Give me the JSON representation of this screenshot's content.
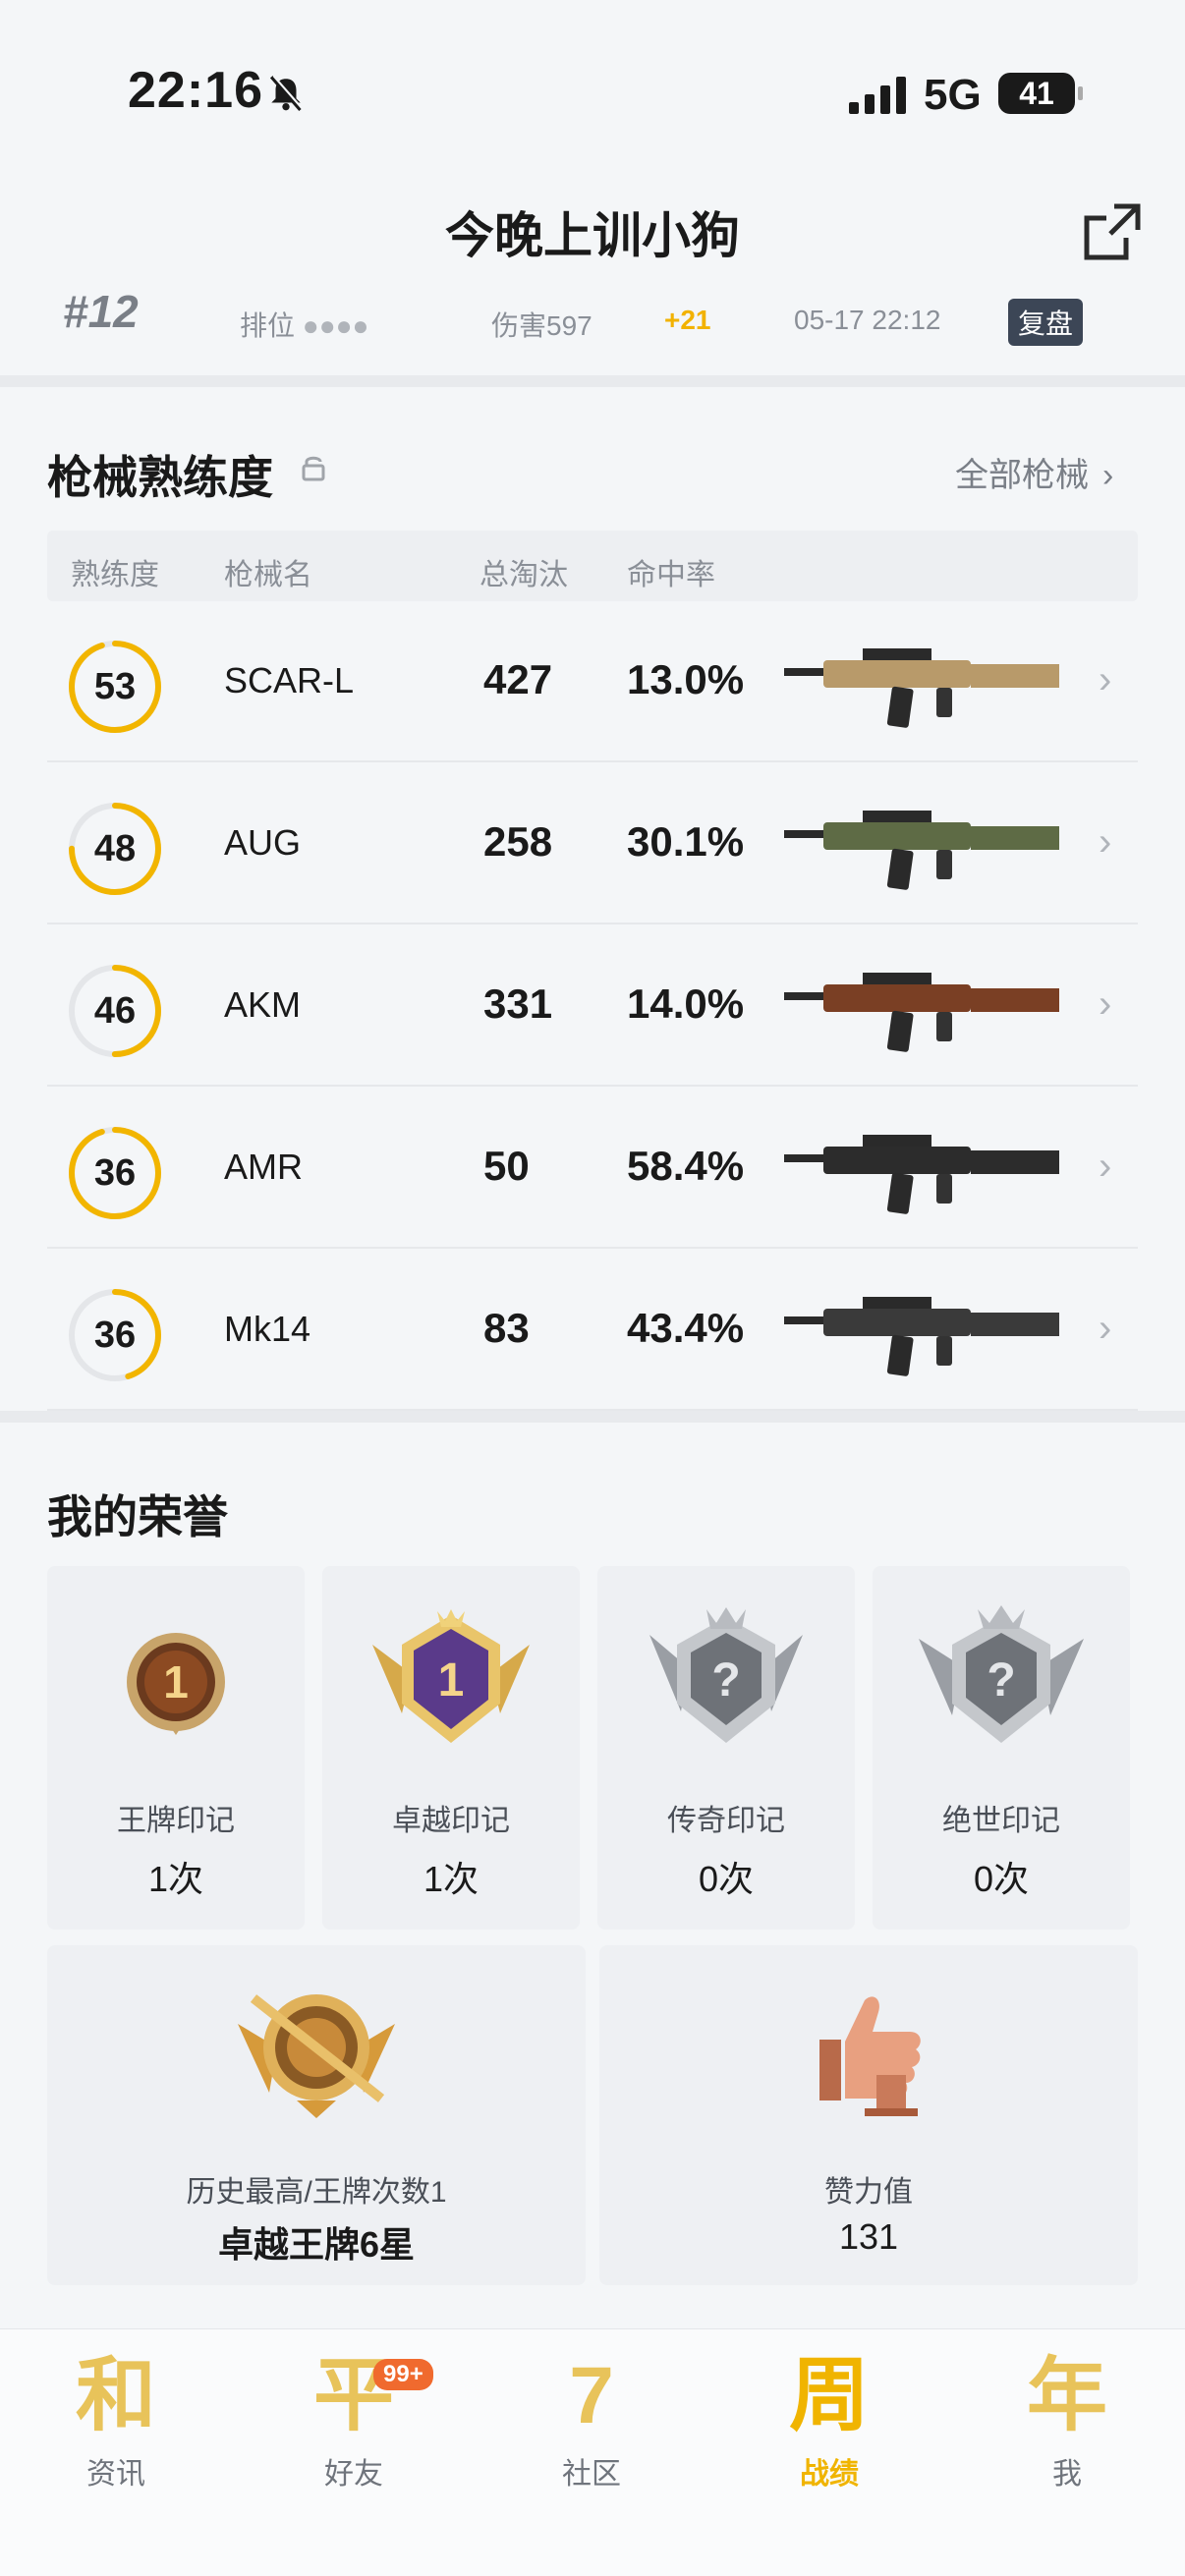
{
  "status_bar": {
    "time": "22:16",
    "network": "5G",
    "battery": "41"
  },
  "header": {
    "title": "今晚上训小狗"
  },
  "match": {
    "rank": "#12",
    "mode": "排位",
    "damage": "伤害597",
    "rating_change": "+21",
    "date": "05-17 22:12",
    "replay": "复盘"
  },
  "weapons": {
    "title": "枪械熟练度",
    "all_link": "全部枪械",
    "columns": {
      "proficiency": "熟练度",
      "name": "枪械名",
      "kills": "总淘汰",
      "accuracy": "命中率"
    },
    "rows": [
      {
        "level": "53",
        "progress": 0.95,
        "name": "SCAR-L",
        "kills": "427",
        "accuracy": "13.0%",
        "gun_color": "#b89a6a"
      },
      {
        "level": "48",
        "progress": 0.75,
        "name": "AUG",
        "kills": "258",
        "accuracy": "30.1%",
        "gun_color": "#5e6b45"
      },
      {
        "level": "46",
        "progress": 0.5,
        "name": "AKM",
        "kills": "331",
        "accuracy": "14.0%",
        "gun_color": "#7a3f24"
      },
      {
        "level": "36",
        "progress": 0.95,
        "name": "AMR",
        "kills": "50",
        "accuracy": "58.4%",
        "gun_color": "#2c2c2c"
      },
      {
        "level": "36",
        "progress": 0.45,
        "name": "Mk14",
        "kills": "83",
        "accuracy": "43.4%",
        "gun_color": "#3a3a3a"
      }
    ]
  },
  "honors": {
    "title": "我的荣誉",
    "badges": [
      {
        "label": "王牌印记",
        "value": "1次",
        "icon": "ace-mark-icon",
        "badge_text": "1"
      },
      {
        "label": "卓越印记",
        "value": "1次",
        "icon": "excellence-mark-icon",
        "badge_text": "1"
      },
      {
        "label": "传奇印记",
        "value": "0次",
        "icon": "legend-mark-icon",
        "badge_text": "?"
      },
      {
        "label": "绝世印记",
        "value": "0次",
        "icon": "peerless-mark-icon",
        "badge_text": "?"
      }
    ],
    "history": {
      "label": "历史最高/王牌次数1",
      "value": "卓越王牌6星"
    },
    "likes": {
      "label": "赞力值",
      "value": "131"
    }
  },
  "tabbar": {
    "items": [
      {
        "glyph": "和",
        "label": "资讯"
      },
      {
        "glyph": "平",
        "label": "好友",
        "badge": "99+"
      },
      {
        "glyph": "7",
        "label": "社区"
      },
      {
        "glyph": "周",
        "label": "战绩"
      },
      {
        "glyph": "年",
        "label": "我"
      }
    ]
  }
}
